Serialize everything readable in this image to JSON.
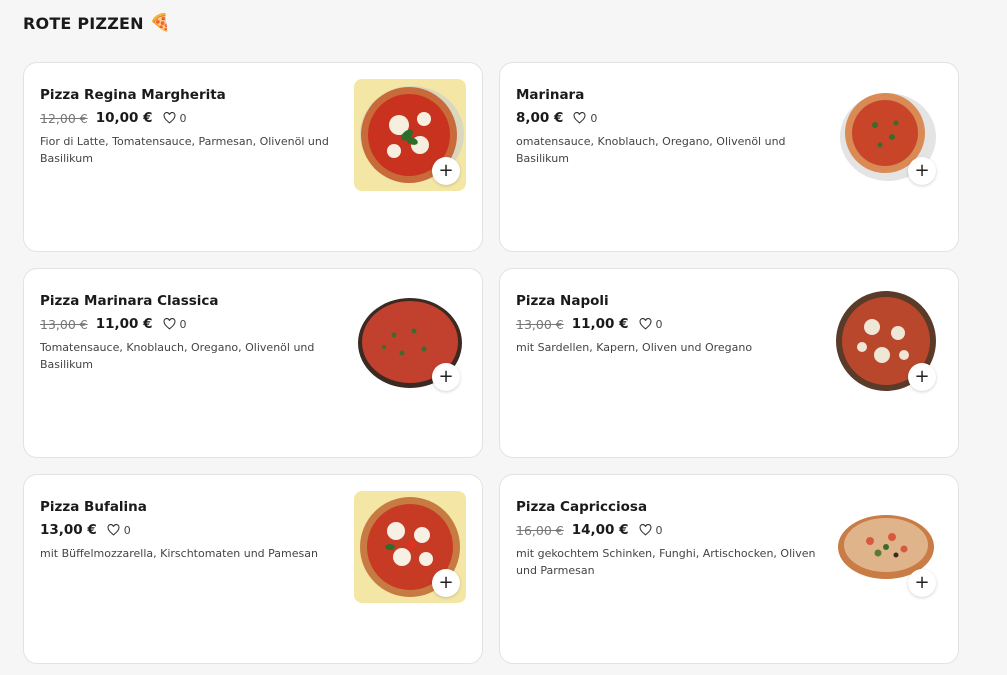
{
  "section": {
    "title": "ROTE PIZZEN",
    "emoji": "🍕"
  },
  "add_symbol": "+",
  "items": [
    {
      "name": "Pizza Regina Margherita",
      "old_price": "12,00 €",
      "price": "10,00 €",
      "likes": "0",
      "description": "Fior di Latte, Tomatensauce, Parmesan, Olivenöl und Basilikum",
      "image_bg": "#f4e7a6"
    },
    {
      "name": "Marinara",
      "old_price": "",
      "price": "8,00 €",
      "likes": "0",
      "description": "omatensauce, Knoblauch, Oregano, Olivenöl und Basilikum",
      "image_bg": "#ffffff"
    },
    {
      "name": "Pizza Marinara Classica",
      "old_price": "13,00 €",
      "price": "11,00 €",
      "likes": "0",
      "description": "Tomatensauce, Knoblauch, Oregano, Olivenöl und Basilikum",
      "image_bg": "#ffffff"
    },
    {
      "name": "Pizza Napoli",
      "old_price": "13,00 €",
      "price": "11,00 €",
      "likes": "0",
      "description": "mit Sardellen, Kapern, Oliven und Oregano",
      "image_bg": "#ffffff"
    },
    {
      "name": "Pizza Bufalina",
      "old_price": "",
      "price": "13,00 €",
      "likes": "0",
      "description": "mit Büffelmozzarella, Kirschtomaten und Pamesan",
      "image_bg": "#f4e7a6"
    },
    {
      "name": "Pizza Capricciosa",
      "old_price": "16,00 €",
      "price": "14,00 €",
      "likes": "0",
      "description": "mit gekochtem Schinken, Funghi, Artischocken, Oliven und Parmesan",
      "image_bg": "#ffffff"
    }
  ]
}
